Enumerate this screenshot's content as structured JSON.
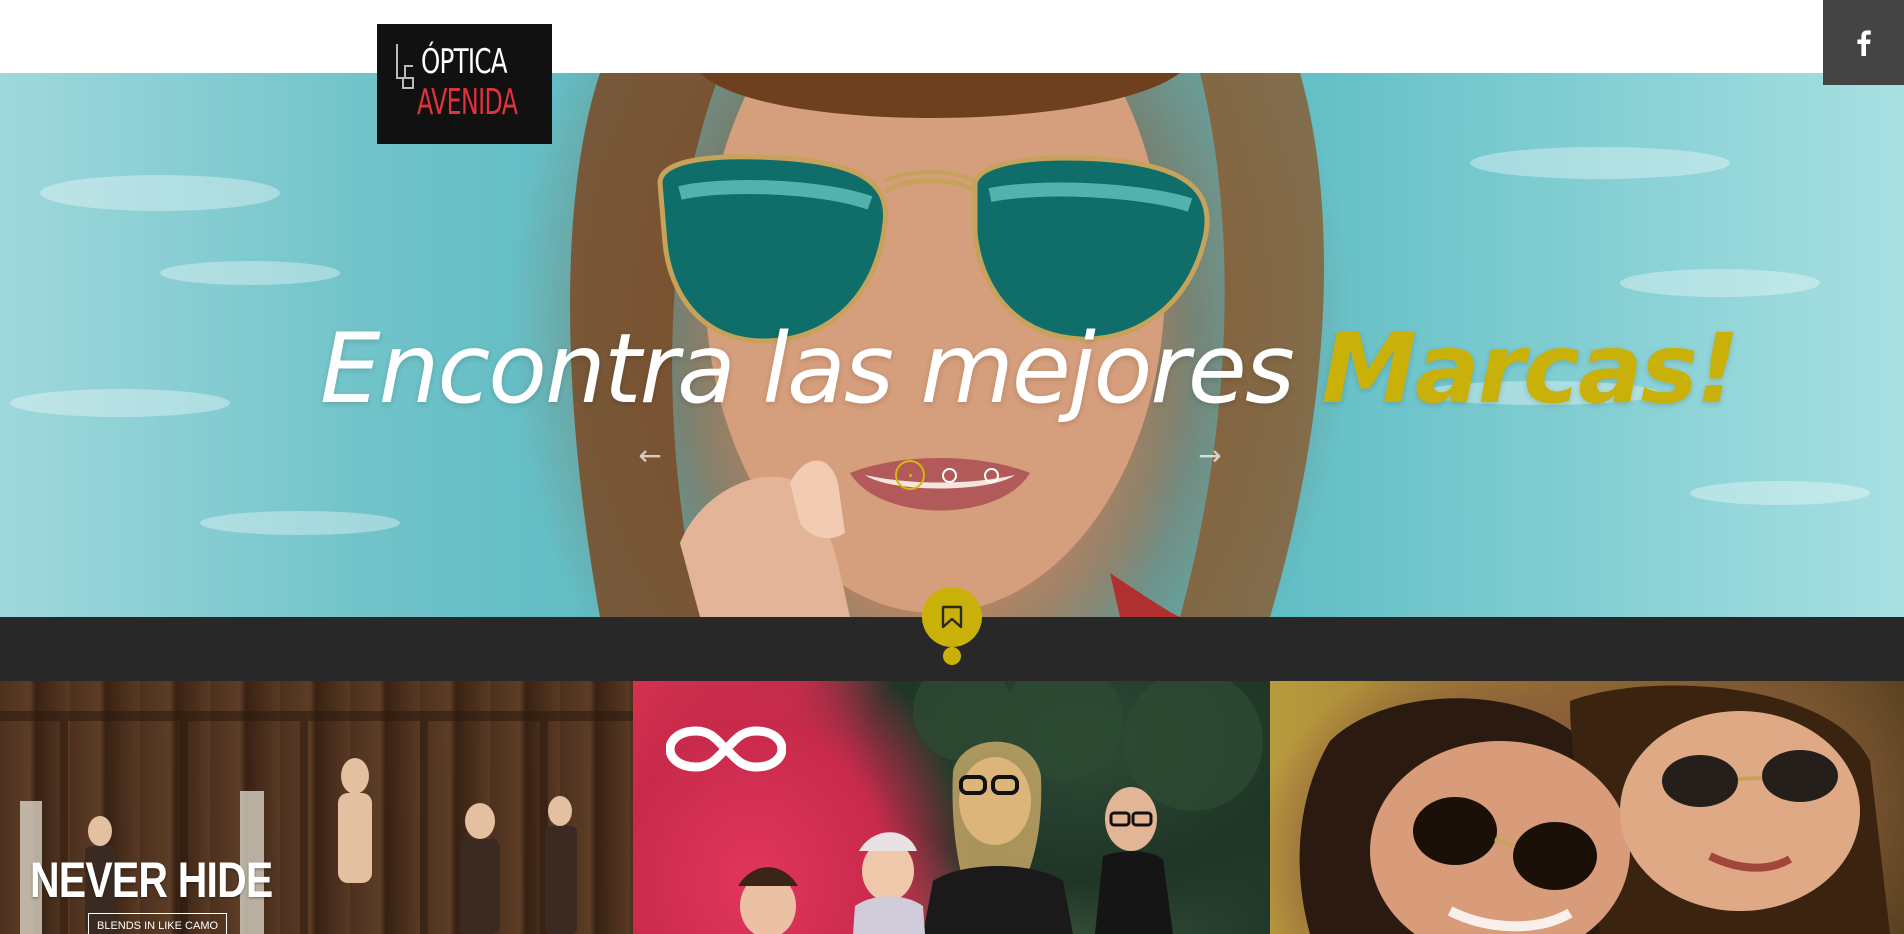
{
  "brand": {
    "line1": "ÓPTICA",
    "line2": "AVENIDA"
  },
  "social": {
    "facebook_icon": "facebook-icon",
    "facebook_label": "f"
  },
  "hero": {
    "title_main": "Encontra las mejores ",
    "title_accent": "Marcas!",
    "prev_arrow": "←",
    "next_arrow": "→",
    "slides_count": 3,
    "active_slide": 1
  },
  "strip": {
    "badge_icon": "bookmark-icon"
  },
  "gallery": {
    "tiles": [
      {
        "label": "NEVER HIDE",
        "sub": "BLENDS IN LIKE CAMO"
      },
      {
        "label": "",
        "icon": "infinity-icon"
      },
      {
        "label": ""
      }
    ]
  },
  "colors": {
    "accent": "#c9b10a",
    "logo_red": "#e0323a",
    "dark_strip": "#282828",
    "fb_bg": "#444444"
  }
}
